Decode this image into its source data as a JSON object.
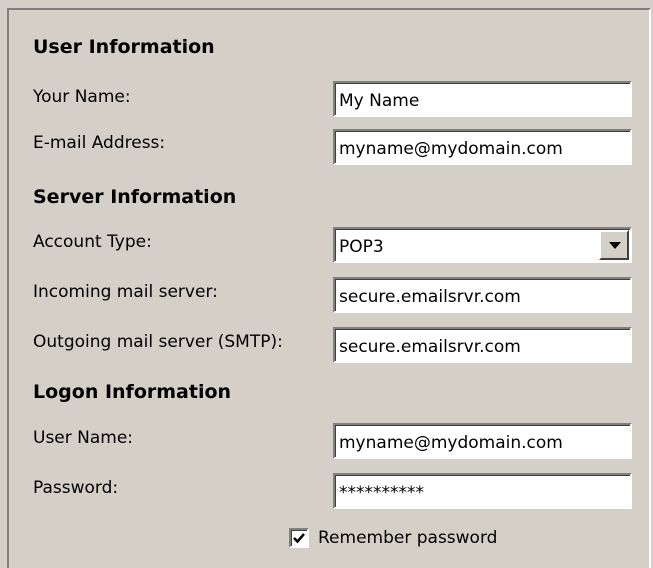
{
  "user_info": {
    "heading": "User Information",
    "name_label": "Your Name:",
    "name_value": "My Name",
    "email_label": "E-mail Address:",
    "email_value": "myname@mydomain.com"
  },
  "server_info": {
    "heading": "Server Information",
    "account_type_label": "Account Type:",
    "account_type_value": "POP3",
    "incoming_label": "Incoming mail server:",
    "incoming_value": "secure.emailsrvr.com",
    "outgoing_label": "Outgoing mail server (SMTP):",
    "outgoing_value": "secure.emailsrvr.com"
  },
  "logon_info": {
    "heading": "Logon Information",
    "username_label": "User Name:",
    "username_value": "myname@mydomain.com",
    "password_label": "Password:",
    "password_value": "**********",
    "remember_label": "Remember password",
    "remember_checked": true
  },
  "icons": {
    "dropdown": "chevron-down-icon",
    "check": "checkmark-icon"
  },
  "colors": {
    "background": "#d4d0c8",
    "field_background": "#ffffff"
  }
}
